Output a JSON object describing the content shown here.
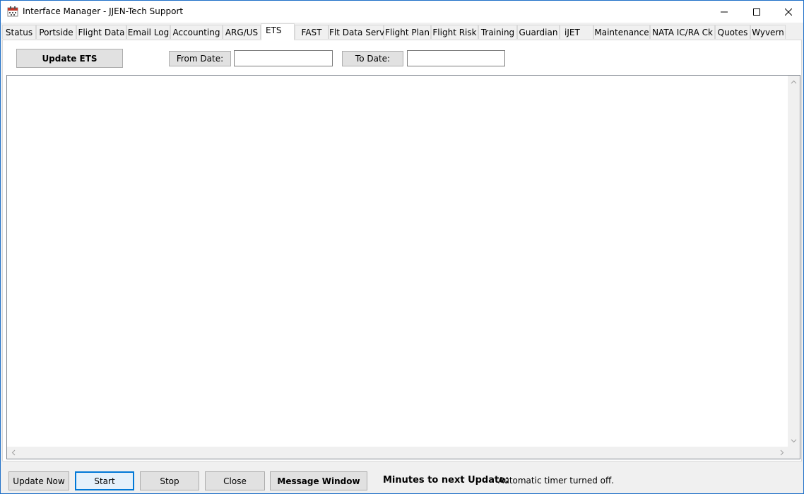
{
  "window": {
    "title": "Interface Manager - JJEN-Tech Support",
    "icon": "calendar-app-icon"
  },
  "tabs": [
    {
      "label": "Status"
    },
    {
      "label": "Portside"
    },
    {
      "label": "Flight Data"
    },
    {
      "label": "Email Log"
    },
    {
      "label": "Accounting"
    },
    {
      "label": "ARG/US"
    },
    {
      "label": "ETS",
      "active": true
    },
    {
      "label": "FAST"
    },
    {
      "label": "Flt Data Serv"
    },
    {
      "label": "Flight Plan"
    },
    {
      "label": "Flight Risk"
    },
    {
      "label": "Training"
    },
    {
      "label": "Guardian"
    },
    {
      "label": "iJET"
    },
    {
      "label": "Maintenance"
    },
    {
      "label": "NATA IC/RA Ck"
    },
    {
      "label": "Quotes"
    },
    {
      "label": "Wyvern"
    }
  ],
  "ets": {
    "update_button": "Update ETS",
    "from_date_label": "From Date:",
    "from_date_value": "",
    "to_date_label": "To Date:",
    "to_date_value": "",
    "output_text": ""
  },
  "footer": {
    "update_now": "Update Now",
    "start": "Start",
    "stop": "Stop",
    "close": "Close",
    "message_window": "Message Window",
    "minutes_label": "Minutes to next Update:",
    "timer_status": "Automatic timer turned off."
  }
}
